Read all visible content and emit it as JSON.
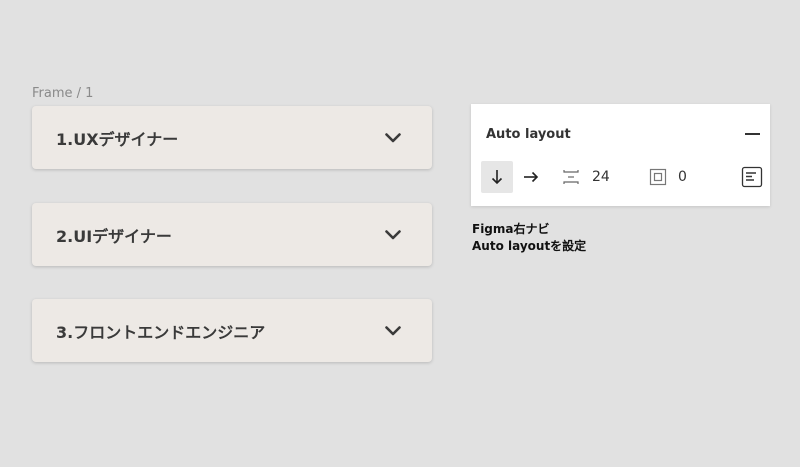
{
  "canvas": {
    "frame_label": "Frame / 1",
    "accordions": [
      {
        "title": "1.UXデザイナー",
        "icon": "chevron-down-icon"
      },
      {
        "title": "2.UIデザイナー",
        "icon": "chevron-down-icon"
      },
      {
        "title": "3.フロントエンドエンジニア",
        "icon": "chevron-down-icon"
      }
    ]
  },
  "auto_layout_panel": {
    "title": "Auto layout",
    "remove_icon": "minus-icon",
    "direction_vertical_icon": "arrow-down-icon",
    "direction_horizontal_icon": "arrow-right-icon",
    "spacing_icon": "spacing-between-icon",
    "spacing_value": "24",
    "padding_icon": "padding-icon",
    "padding_value": "0",
    "alignment_icon": "alignment-icon"
  },
  "caption": {
    "line1": "Figma右ナビ",
    "line2": "Auto layoutを設定"
  },
  "colors": {
    "canvas_bg": "#e1e1e1",
    "accordion_bg": "#ede9e5",
    "panel_bg": "#ffffff",
    "selected_direction_bg": "#e6e6e6"
  }
}
